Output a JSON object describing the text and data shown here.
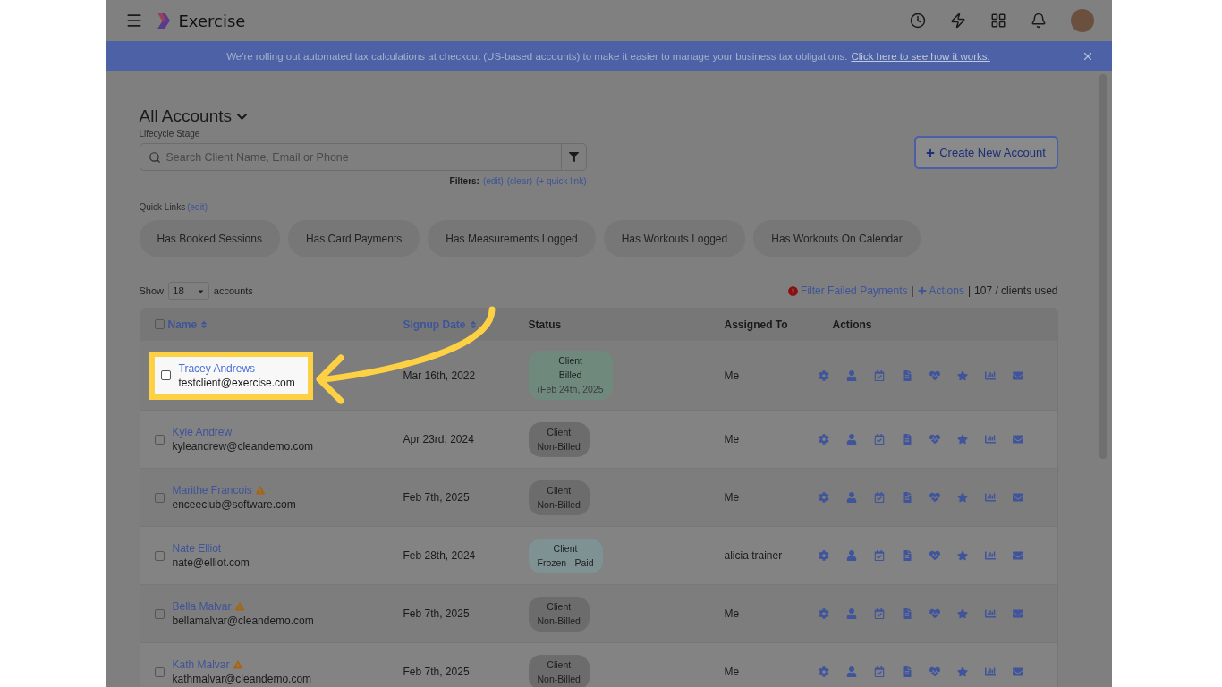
{
  "topbar": {
    "logo_text": "Exercise"
  },
  "banner": {
    "text": "We're rolling out automated tax calculations at checkout (US-based accounts) to make it easier to manage your business tax obligations.",
    "link": "Click here to see how it works."
  },
  "heading": {
    "title": "All Accounts",
    "subtitle": "Lifecycle Stage"
  },
  "search": {
    "placeholder": "Search Client Name, Email or Phone"
  },
  "filters": {
    "label": "Filters:",
    "links": [
      "(edit)",
      "(clear)",
      "(+ quick link)"
    ]
  },
  "create_button": "Create New Account",
  "quick_links": {
    "label": "Quick Links",
    "edit": "(edit)",
    "items": [
      "Has Booked Sessions",
      "Has Card Payments",
      "Has Measurements Logged",
      "Has Workouts Logged",
      "Has Workouts On Calendar"
    ]
  },
  "show": {
    "label": "Show",
    "value": "18",
    "suffix": "accounts"
  },
  "tools": [
    {
      "kind": "alert-link",
      "text": "Filter Failed Payments"
    },
    {
      "kind": "separator",
      "text": "|"
    },
    {
      "kind": "add-link",
      "text": "Actions"
    },
    {
      "kind": "separator",
      "text": "|"
    },
    {
      "kind": "text",
      "text": "107 / clients used"
    }
  ],
  "table": {
    "select_all_checked": false,
    "columns": [
      {
        "label": "Name",
        "sortable": true
      },
      {
        "label": "Signup Date",
        "sortable": true
      },
      {
        "label": "Status",
        "sortable": false
      },
      {
        "label": "Assigned To",
        "sortable": false
      },
      {
        "label": "Actions",
        "sortable": false
      }
    ],
    "rows": [
      {
        "name": "Tracey Andrews",
        "email": "testclient@exercise.com",
        "warning": false,
        "checked": false,
        "highlighted": true,
        "date": "Mar 16th, 2022",
        "status": {
          "kind": "billed",
          "lines": [
            "Client",
            "Billed",
            "(Feb 24th, 2025"
          ]
        },
        "assigned": "Me"
      },
      {
        "name": "Kyle Andrew",
        "email": "kyleandrew@cleandemo.com",
        "warning": false,
        "checked": false,
        "highlighted": false,
        "date": "Apr 23rd, 2024",
        "status": {
          "kind": "non-billed",
          "lines": [
            "Client",
            "Non-Billed"
          ]
        },
        "assigned": "Me"
      },
      {
        "name": "Marithe Francois",
        "email": "enceeclub@software.com",
        "warning": true,
        "checked": false,
        "highlighted": false,
        "date": "Feb 7th, 2025",
        "status": {
          "kind": "non-billed",
          "lines": [
            "Client",
            "Non-Billed"
          ]
        },
        "assigned": "Me"
      },
      {
        "name": "Nate Elliot",
        "email": "nate@elliot.com",
        "warning": false,
        "checked": false,
        "highlighted": false,
        "date": "Feb 28th, 2024",
        "status": {
          "kind": "frozen",
          "lines": [
            "Client",
            "Frozen - Paid"
          ]
        },
        "assigned": "alicia trainer"
      },
      {
        "name": "Bella Malvar",
        "email": "bellamalvar@cleandemo.com",
        "warning": true,
        "checked": false,
        "highlighted": false,
        "date": "Feb 7th, 2025",
        "status": {
          "kind": "non-billed",
          "lines": [
            "Client",
            "Non-Billed"
          ]
        },
        "assigned": "Me"
      },
      {
        "name": "Kath Malvar",
        "email": "kathmalvar@cleandemo.com",
        "warning": true,
        "checked": false,
        "highlighted": false,
        "date": "Feb 7th, 2025",
        "status": {
          "kind": "non-billed",
          "lines": [
            "Client",
            "Non-Billed"
          ]
        },
        "assigned": "Me"
      }
    ]
  }
}
